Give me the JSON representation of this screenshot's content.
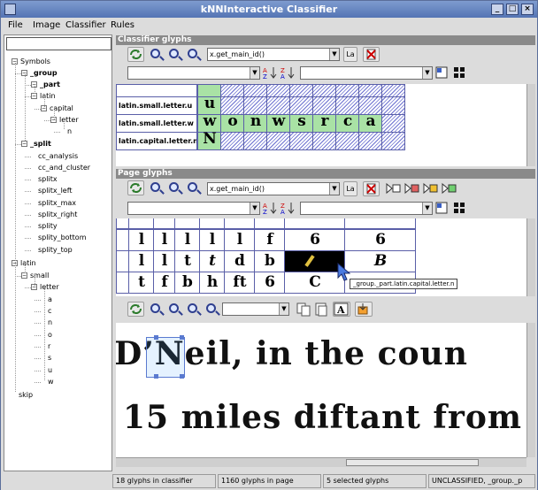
{
  "window": {
    "title": "kNNInteractive Classifier",
    "min": "_",
    "max": "□",
    "close": "×"
  },
  "menu": [
    {
      "label": "File"
    },
    {
      "label": "Image"
    },
    {
      "label": "Classifier"
    },
    {
      "label": "Rules"
    }
  ],
  "tree": {
    "search_value": "",
    "nodes": [
      {
        "label": "Symbols",
        "bold": false
      },
      {
        "label": "_group",
        "bold": true
      },
      {
        "label": "_part",
        "bold": true
      },
      {
        "label": "latin",
        "bold": false
      },
      {
        "label": "capital",
        "bold": false
      },
      {
        "label": "letter",
        "bold": false
      },
      {
        "label": "n",
        "bold": false
      },
      {
        "label": "_split",
        "bold": true
      },
      {
        "label": "cc_analysis",
        "bold": false
      },
      {
        "label": "cc_and_cluster",
        "bold": false
      },
      {
        "label": "splitx",
        "bold": false
      },
      {
        "label": "splitx_left",
        "bold": false
      },
      {
        "label": "splitx_max",
        "bold": false
      },
      {
        "label": "splitx_right",
        "bold": false
      },
      {
        "label": "splity",
        "bold": false
      },
      {
        "label": "splity_bottom",
        "bold": false
      },
      {
        "label": "splity_top",
        "bold": false
      },
      {
        "label": "latin",
        "bold": false
      },
      {
        "label": "small",
        "bold": false
      },
      {
        "label": "letter",
        "bold": false
      },
      {
        "label": "a",
        "bold": false
      },
      {
        "label": "c",
        "bold": false
      },
      {
        "label": "n",
        "bold": false
      },
      {
        "label": "o",
        "bold": false
      },
      {
        "label": "r",
        "bold": false
      },
      {
        "label": "s",
        "bold": false
      },
      {
        "label": "u",
        "bold": false
      },
      {
        "label": "w",
        "bold": false
      },
      {
        "label": "skip",
        "bold": false
      }
    ]
  },
  "classifier_panel": {
    "header": "Classifier glyphs",
    "sort_expr": "x.get_main_id()",
    "label_btn": "La",
    "rows": [
      {
        "label": "latin.small.letter.u",
        "glyphs": [
          "u"
        ]
      },
      {
        "label": "latin.small.letter.w",
        "glyphs": [
          "w",
          "o",
          "n",
          "w",
          "s",
          "r",
          "c",
          "a"
        ]
      },
      {
        "label": "latin.capital.letter.n",
        "glyphs": [
          "N"
        ]
      }
    ]
  },
  "page_panel": {
    "header": "Page glyphs",
    "sort_expr": "x.get_main_id()",
    "label_btn": "La",
    "rows": [
      {
        "glyphs": [
          "l",
          "l",
          "l",
          "l",
          "l",
          "f",
          "6",
          "6"
        ]
      },
      {
        "glyphs": [
          "l",
          "l",
          "t",
          "t",
          "d",
          "b",
          "",
          "B"
        ]
      },
      {
        "glyphs": [
          "t",
          "f",
          "b",
          "h",
          "ft",
          "6",
          "C",
          ""
        ]
      }
    ],
    "tooltip": "_group._part.latin.capital.letter.n"
  },
  "document": {
    "line1": "D’Neil,  in  the  coun",
    "line2": "15 miles diftant from",
    "zoom_value": ""
  },
  "status": {
    "classifier_count": "18 glyphs in classifier",
    "page_count": "1160 glyphs in page",
    "selected": "5 selected glyphs",
    "classification": "UNCLASSIFIED, _group._p"
  },
  "colors": {
    "accent": "#5474b4",
    "hatch": "#6a6fcf",
    "classified": "#a9e2a5"
  }
}
